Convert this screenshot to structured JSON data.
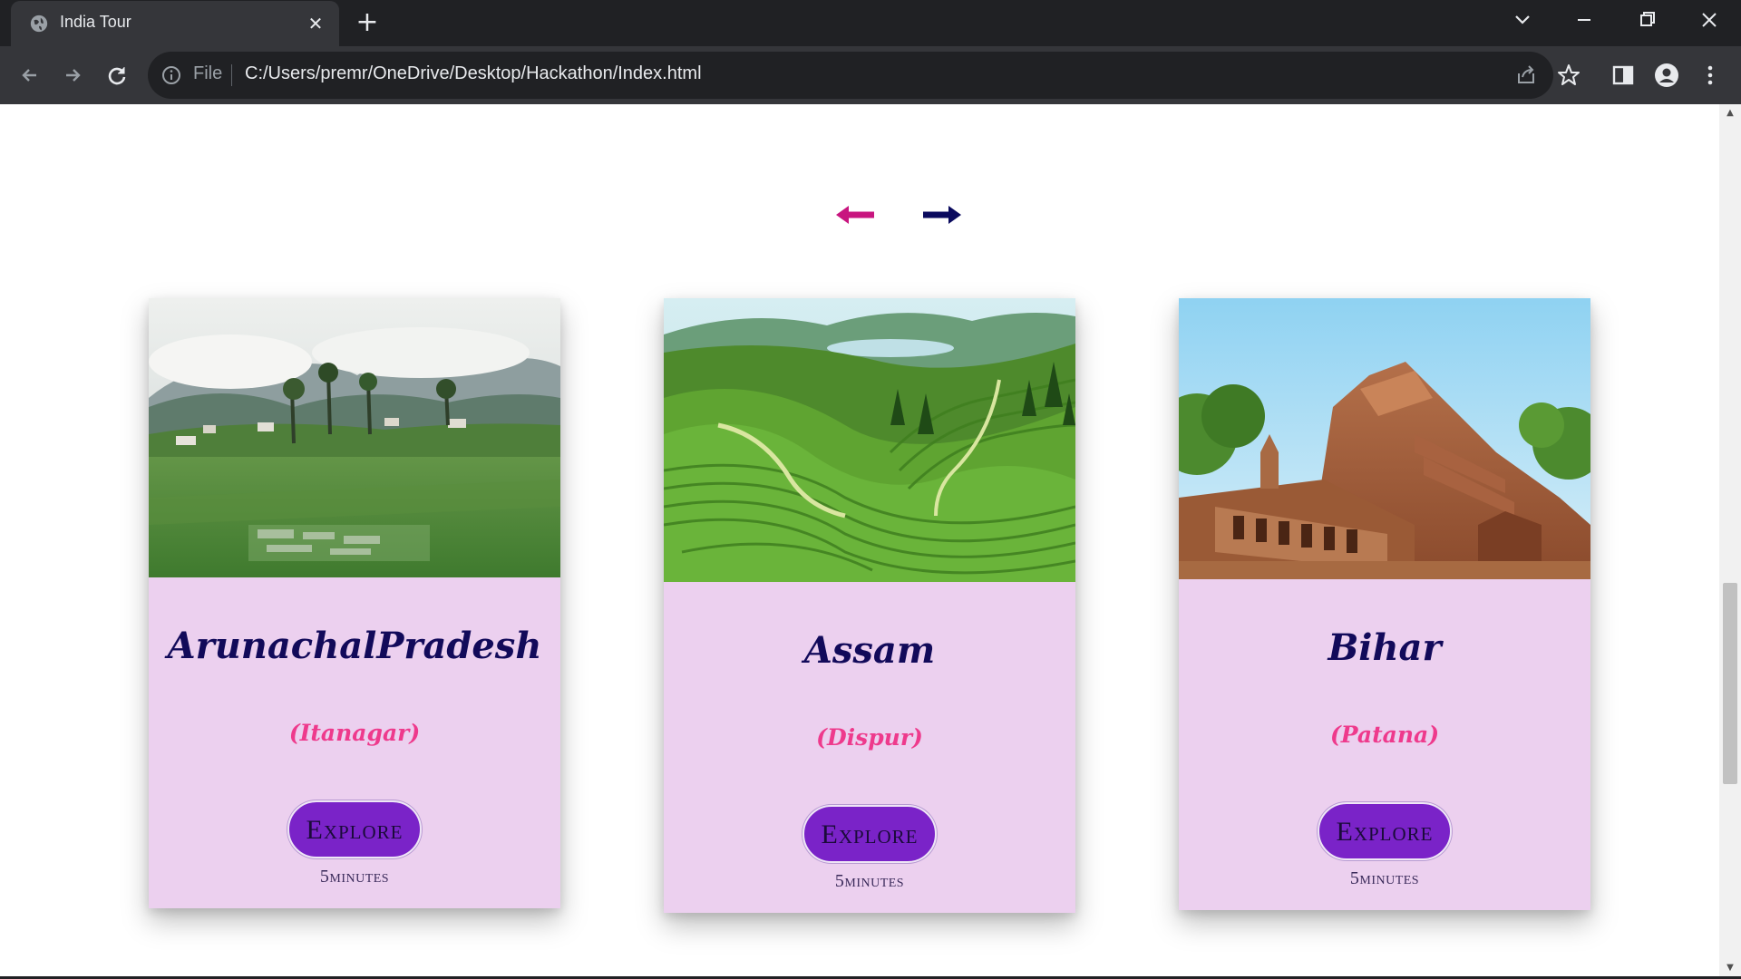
{
  "browser": {
    "tab_title": "India Tour",
    "omnibox_scheme": "File",
    "url": "C:/Users/premr/OneDrive/Desktop/Hackathon/Index.html"
  },
  "colors": {
    "prev_arrow": "#c8157f",
    "next_arrow": "#0a0a5e",
    "card_bg": "#ecd0ef",
    "title": "#120a5a",
    "capital": "#ee3a8c",
    "button": "#7a23c8"
  },
  "slider": {
    "prev_icon": "arrow-left-icon",
    "next_icon": "arrow-right-icon"
  },
  "cards": [
    {
      "state": "ArunachalPradesh",
      "capital": "(Itanagar)",
      "button": "Explore",
      "duration": "5minutes",
      "image": "hills-village-photo"
    },
    {
      "state": "Assam",
      "capital": "(Dispur)",
      "button": "Explore",
      "duration": "5minutes",
      "image": "tea-garden-photo"
    },
    {
      "state": "Bihar",
      "capital": "(Patana)",
      "button": "Explore",
      "duration": "5minutes",
      "image": "nalanda-ruins-photo"
    }
  ]
}
